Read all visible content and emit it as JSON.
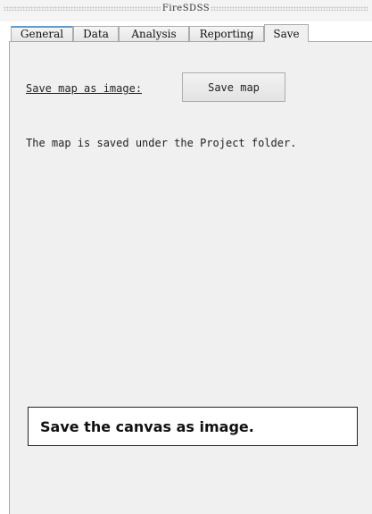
{
  "window": {
    "title": "FireSDSS"
  },
  "tabs": [
    {
      "label": "General",
      "active": false
    },
    {
      "label": "Data",
      "active": false
    },
    {
      "label": "Analysis",
      "active": false
    },
    {
      "label": "Reporting",
      "active": false
    },
    {
      "label": "Save",
      "active": true
    }
  ],
  "save_panel": {
    "save_label": "Save map as image:",
    "save_button": "Save map",
    "info_text": "The map is saved under the Project folder."
  },
  "caption": {
    "text": "Save the canvas as image."
  },
  "colors": {
    "panel_background": "#f0f0f0",
    "tab_highlight": "#5b9bd5"
  }
}
